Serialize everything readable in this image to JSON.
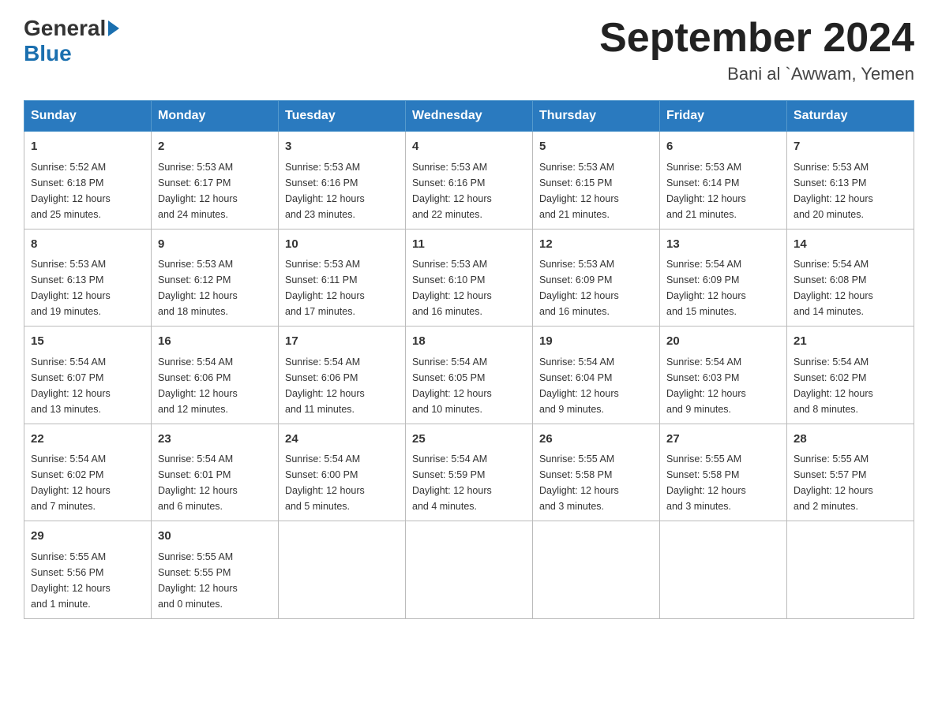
{
  "header": {
    "logo": {
      "general": "General",
      "triangle": "▶",
      "blue": "Blue"
    },
    "title": "September 2024",
    "location": "Bani al `Awwam, Yemen"
  },
  "days_of_week": [
    "Sunday",
    "Monday",
    "Tuesday",
    "Wednesday",
    "Thursday",
    "Friday",
    "Saturday"
  ],
  "weeks": [
    [
      {
        "day": "1",
        "sunrise": "5:52 AM",
        "sunset": "6:18 PM",
        "daylight": "12 hours and 25 minutes."
      },
      {
        "day": "2",
        "sunrise": "5:53 AM",
        "sunset": "6:17 PM",
        "daylight": "12 hours and 24 minutes."
      },
      {
        "day": "3",
        "sunrise": "5:53 AM",
        "sunset": "6:16 PM",
        "daylight": "12 hours and 23 minutes."
      },
      {
        "day": "4",
        "sunrise": "5:53 AM",
        "sunset": "6:16 PM",
        "daylight": "12 hours and 22 minutes."
      },
      {
        "day": "5",
        "sunrise": "5:53 AM",
        "sunset": "6:15 PM",
        "daylight": "12 hours and 21 minutes."
      },
      {
        "day": "6",
        "sunrise": "5:53 AM",
        "sunset": "6:14 PM",
        "daylight": "12 hours and 21 minutes."
      },
      {
        "day": "7",
        "sunrise": "5:53 AM",
        "sunset": "6:13 PM",
        "daylight": "12 hours and 20 minutes."
      }
    ],
    [
      {
        "day": "8",
        "sunrise": "5:53 AM",
        "sunset": "6:13 PM",
        "daylight": "12 hours and 19 minutes."
      },
      {
        "day": "9",
        "sunrise": "5:53 AM",
        "sunset": "6:12 PM",
        "daylight": "12 hours and 18 minutes."
      },
      {
        "day": "10",
        "sunrise": "5:53 AM",
        "sunset": "6:11 PM",
        "daylight": "12 hours and 17 minutes."
      },
      {
        "day": "11",
        "sunrise": "5:53 AM",
        "sunset": "6:10 PM",
        "daylight": "12 hours and 16 minutes."
      },
      {
        "day": "12",
        "sunrise": "5:53 AM",
        "sunset": "6:09 PM",
        "daylight": "12 hours and 16 minutes."
      },
      {
        "day": "13",
        "sunrise": "5:54 AM",
        "sunset": "6:09 PM",
        "daylight": "12 hours and 15 minutes."
      },
      {
        "day": "14",
        "sunrise": "5:54 AM",
        "sunset": "6:08 PM",
        "daylight": "12 hours and 14 minutes."
      }
    ],
    [
      {
        "day": "15",
        "sunrise": "5:54 AM",
        "sunset": "6:07 PM",
        "daylight": "12 hours and 13 minutes."
      },
      {
        "day": "16",
        "sunrise": "5:54 AM",
        "sunset": "6:06 PM",
        "daylight": "12 hours and 12 minutes."
      },
      {
        "day": "17",
        "sunrise": "5:54 AM",
        "sunset": "6:06 PM",
        "daylight": "12 hours and 11 minutes."
      },
      {
        "day": "18",
        "sunrise": "5:54 AM",
        "sunset": "6:05 PM",
        "daylight": "12 hours and 10 minutes."
      },
      {
        "day": "19",
        "sunrise": "5:54 AM",
        "sunset": "6:04 PM",
        "daylight": "12 hours and 9 minutes."
      },
      {
        "day": "20",
        "sunrise": "5:54 AM",
        "sunset": "6:03 PM",
        "daylight": "12 hours and 9 minutes."
      },
      {
        "day": "21",
        "sunrise": "5:54 AM",
        "sunset": "6:02 PM",
        "daylight": "12 hours and 8 minutes."
      }
    ],
    [
      {
        "day": "22",
        "sunrise": "5:54 AM",
        "sunset": "6:02 PM",
        "daylight": "12 hours and 7 minutes."
      },
      {
        "day": "23",
        "sunrise": "5:54 AM",
        "sunset": "6:01 PM",
        "daylight": "12 hours and 6 minutes."
      },
      {
        "day": "24",
        "sunrise": "5:54 AM",
        "sunset": "6:00 PM",
        "daylight": "12 hours and 5 minutes."
      },
      {
        "day": "25",
        "sunrise": "5:54 AM",
        "sunset": "5:59 PM",
        "daylight": "12 hours and 4 minutes."
      },
      {
        "day": "26",
        "sunrise": "5:55 AM",
        "sunset": "5:58 PM",
        "daylight": "12 hours and 3 minutes."
      },
      {
        "day": "27",
        "sunrise": "5:55 AM",
        "sunset": "5:58 PM",
        "daylight": "12 hours and 3 minutes."
      },
      {
        "day": "28",
        "sunrise": "5:55 AM",
        "sunset": "5:57 PM",
        "daylight": "12 hours and 2 minutes."
      }
    ],
    [
      {
        "day": "29",
        "sunrise": "5:55 AM",
        "sunset": "5:56 PM",
        "daylight": "12 hours and 1 minute."
      },
      {
        "day": "30",
        "sunrise": "5:55 AM",
        "sunset": "5:55 PM",
        "daylight": "12 hours and 0 minutes."
      },
      null,
      null,
      null,
      null,
      null
    ]
  ],
  "labels": {
    "sunrise": "Sunrise:",
    "sunset": "Sunset:",
    "daylight": "Daylight:"
  }
}
